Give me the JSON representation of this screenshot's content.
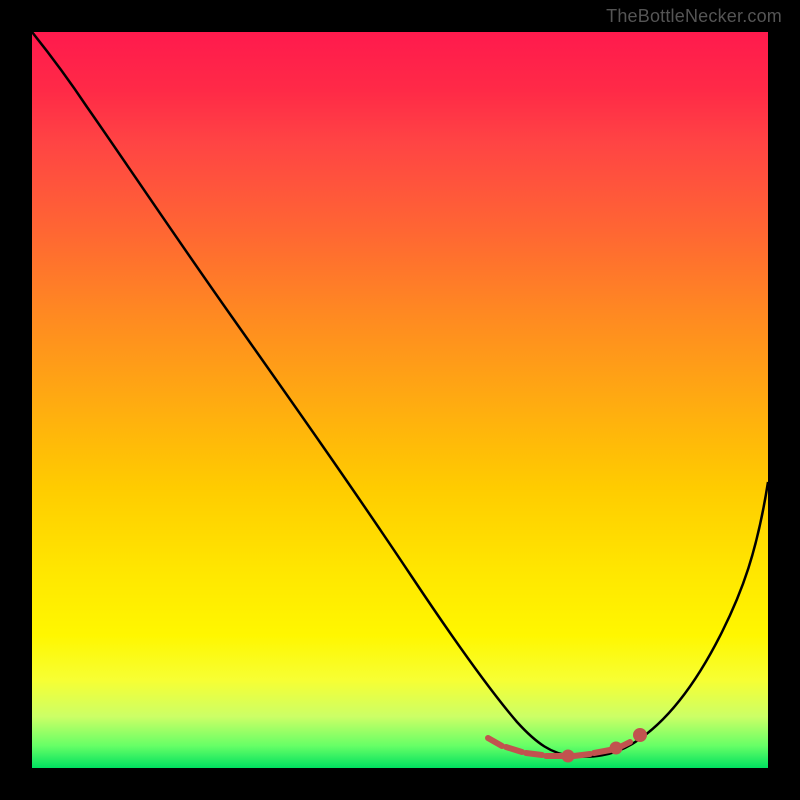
{
  "watermark": "TheBottleNecker.com",
  "colors": {
    "background": "#000000",
    "curve_stroke": "#000000",
    "marker_stroke": "#c1534f",
    "gradient_top": "#ff1a4d",
    "gradient_bottom": "#00e060"
  },
  "chart_data": {
    "type": "line",
    "title": "",
    "xlabel": "",
    "ylabel": "",
    "xlim": [
      0,
      100
    ],
    "ylim": [
      0,
      100
    ],
    "grid": false,
    "legend": false,
    "series": [
      {
        "name": "bottleneck-curve",
        "x": [
          0,
          3,
          7,
          12,
          18,
          24,
          30,
          36,
          42,
          48,
          54,
          58,
          62,
          65,
          68,
          71,
          74,
          77,
          80,
          83,
          87,
          91,
          95,
          100
        ],
        "y": [
          100,
          97,
          93,
          86,
          78,
          70,
          61,
          53,
          44,
          36,
          27,
          20,
          14,
          9,
          5,
          3,
          2,
          2,
          2,
          3,
          8,
          16,
          26,
          39
        ]
      }
    ],
    "markers": {
      "name": "optimal-range",
      "x": [
        62,
        64,
        66,
        68,
        70,
        72,
        74,
        76,
        78,
        80,
        81.5
      ],
      "y": [
        4,
        3,
        2.5,
        2,
        2,
        2,
        2,
        2,
        2.5,
        3.5,
        5
      ]
    }
  }
}
